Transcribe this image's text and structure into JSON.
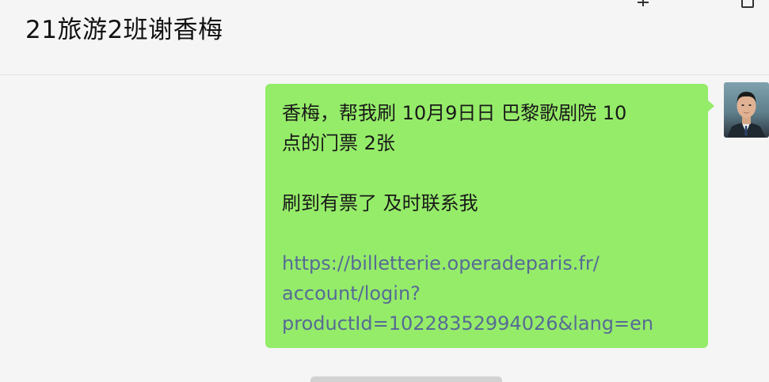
{
  "header": {
    "title": "21旅游2班谢香梅"
  },
  "message": {
    "line1": "香梅，帮我刷 10月9日日 巴黎歌剧院  10",
    "line2": "点的门票 2张",
    "line3": "刷到有票了  及时联系我",
    "url_line1": "https://billetterie.operadeparis.fr/",
    "url_line2": "account/login?",
    "url_line3": "productId=10228352994026&lang=en",
    "bubble_color": "#95ec69",
    "link_color": "#576b95"
  },
  "icons": {
    "add": "plus-icon",
    "window": "window-icon",
    "avatar": "user-avatar"
  }
}
